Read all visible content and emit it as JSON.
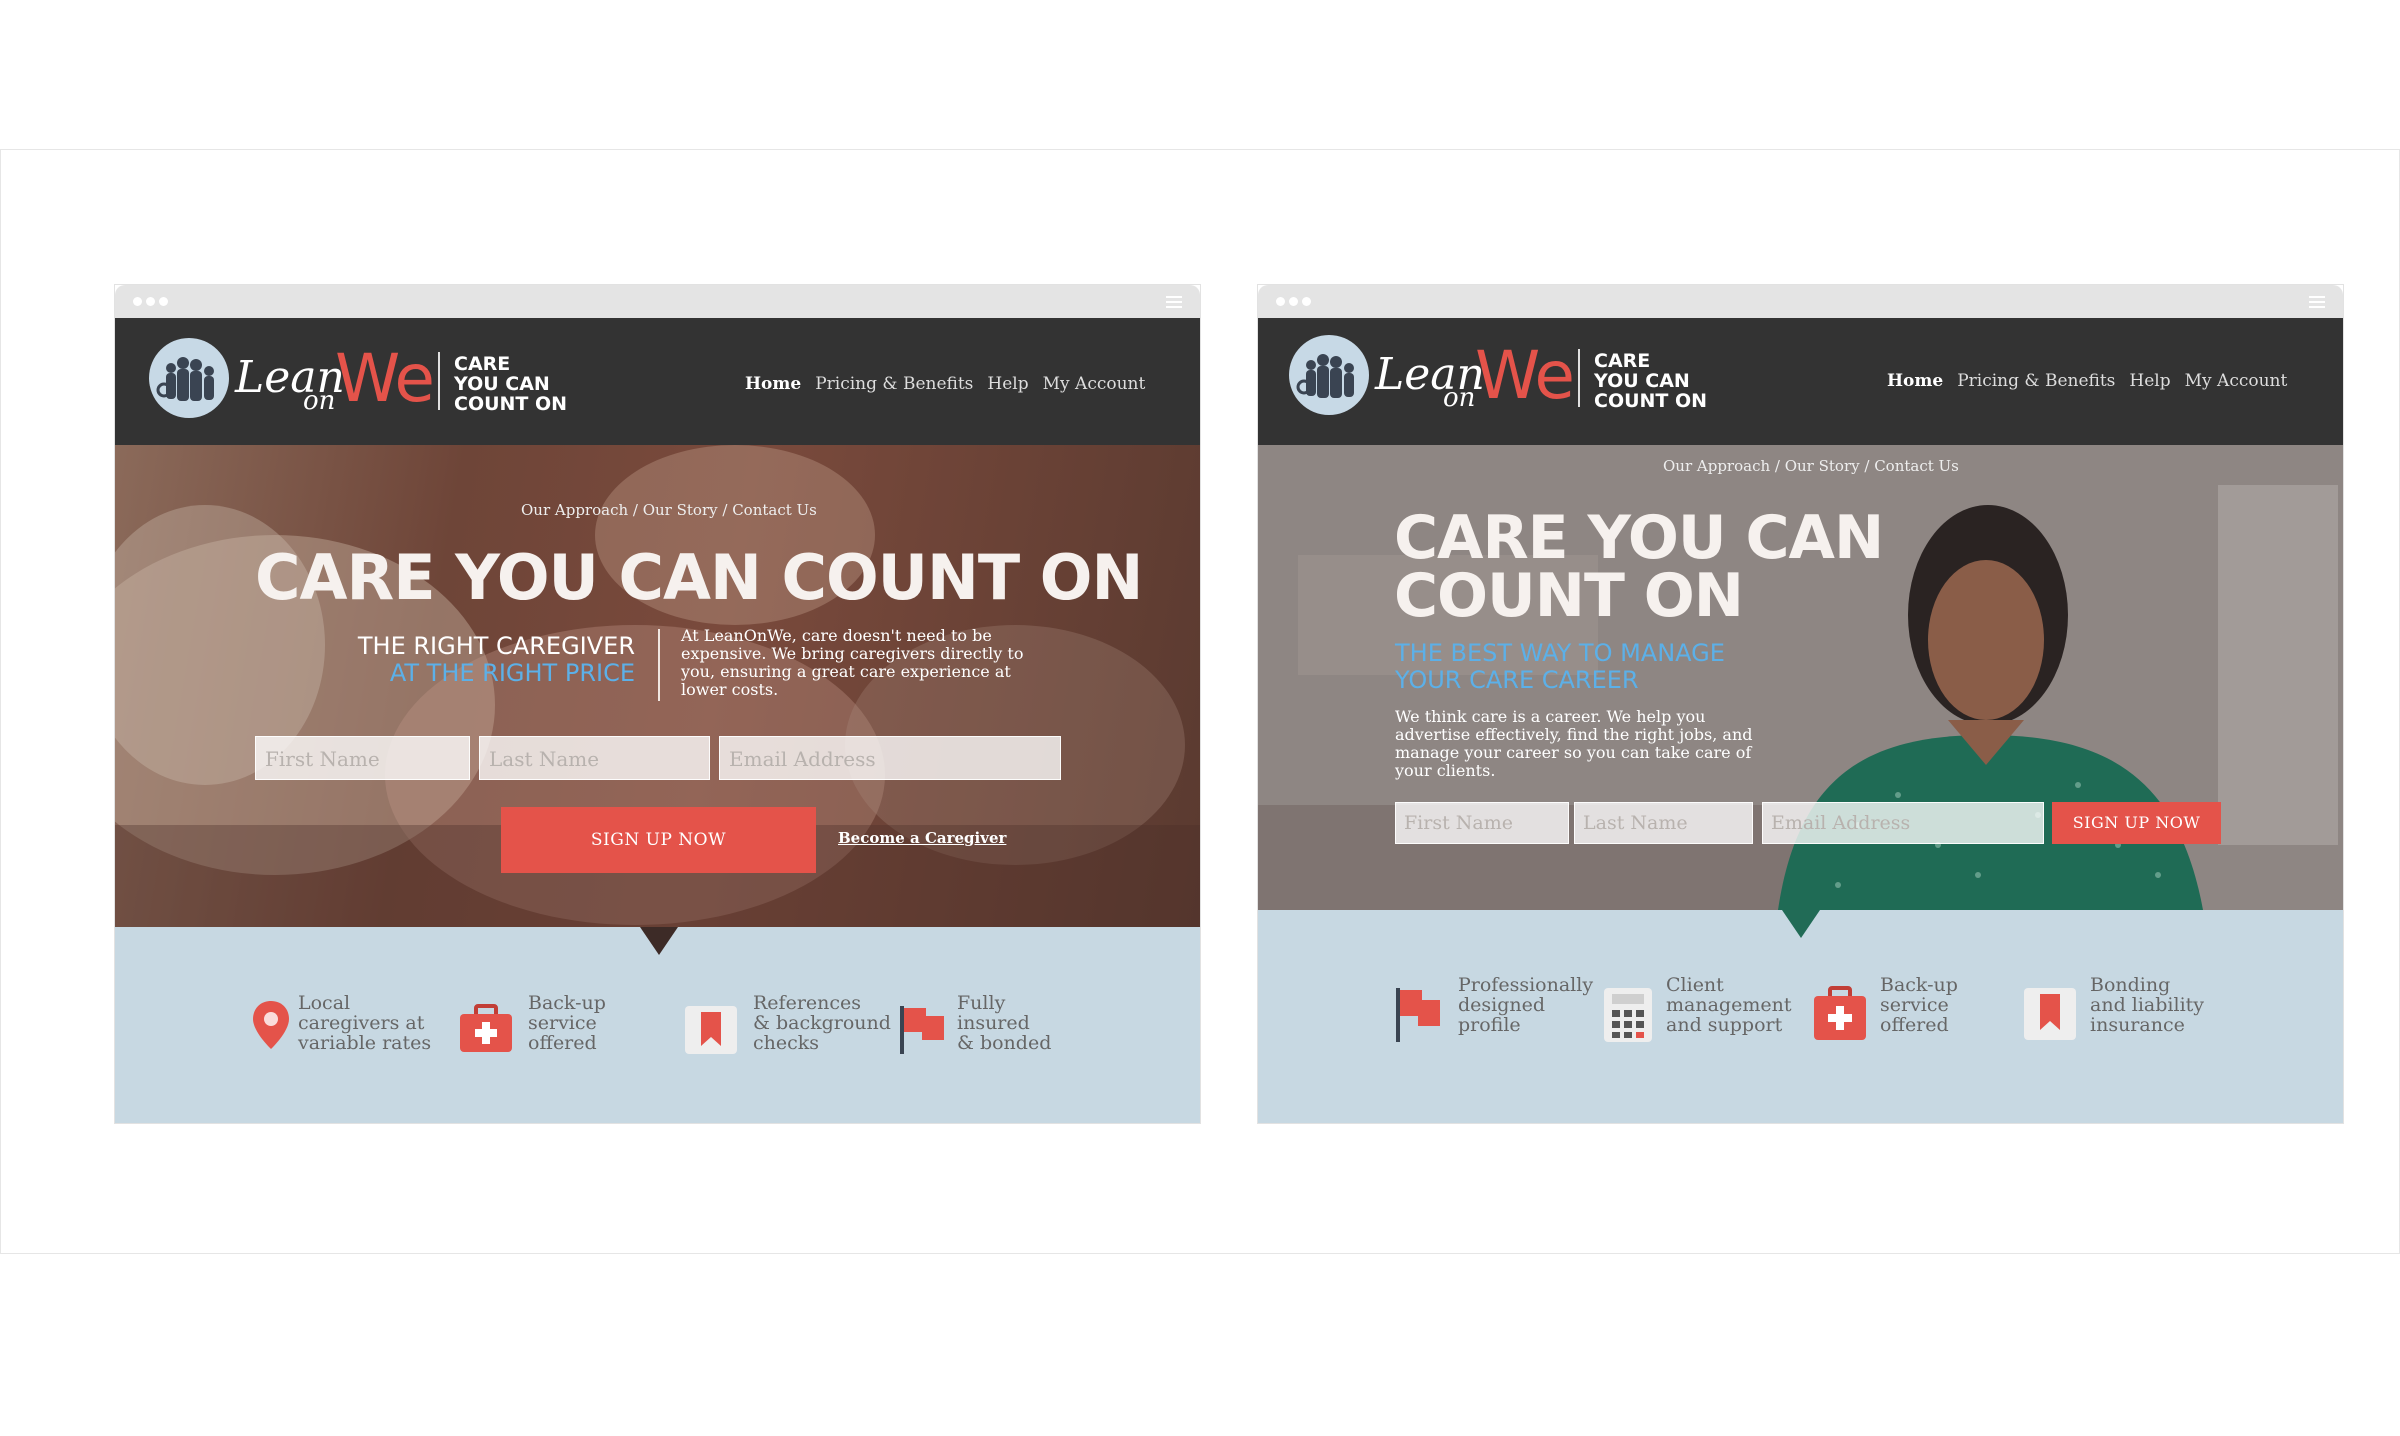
{
  "colors": {
    "accent": "#e4534a",
    "blue": "#5cb0e8",
    "nav_bg": "#333333",
    "feature_bg": "#c7d8e2"
  },
  "left": {
    "brand": {
      "lean": "Lean",
      "on": "on",
      "we": "We",
      "tagline": "CARE\nYOU CAN\nCOUNT ON"
    },
    "nav": [
      "Home",
      "Pricing & Benefits",
      "Help",
      "My Account"
    ],
    "breadcrumb": "Our Approach / Our Story /  Contact Us",
    "headline": "CARE YOU CAN COUNT ON",
    "sub1": "THE RIGHT CAREGIVER",
    "sub2": "AT THE RIGHT PRICE",
    "blurb": "At LeanOnWe, care doesn't need to be expensive. We bring caregivers directly to you, ensuring a great care experience at lower costs.",
    "form": {
      "first": "First Name",
      "last": "Last Name",
      "email": "Email Address",
      "button": "SIGN UP NOW",
      "link": "Become a Caregiver"
    },
    "features": [
      {
        "icon": "map-pin-icon",
        "text": "Local\ncaregivers at\nvariable rates"
      },
      {
        "icon": "first-aid-kit-icon",
        "text": "Back-up\nservice\noffered"
      },
      {
        "icon": "bookmark-icon",
        "text": "References\n& background\nchecks"
      },
      {
        "icon": "flag-icon",
        "text": "Fully\ninsured\n& bonded"
      }
    ]
  },
  "right": {
    "brand": {
      "lean": "Lean",
      "on": "on",
      "we": "We",
      "tagline": "CARE\nYOU CAN\nCOUNT ON"
    },
    "nav": [
      "Home",
      "Pricing & Benefits",
      "Help",
      "My Account"
    ],
    "breadcrumb": "Our Approach / Our Story /  Contact Us",
    "headline1": "CARE YOU CAN",
    "headline2": "COUNT ON",
    "sub1": "THE BEST WAY TO MANAGE",
    "sub2": "YOUR CARE CAREER",
    "blurb": "We think care is a career. We help you advertise effectively, find the right jobs, and manage your career so you can take care of your clients.",
    "form": {
      "first": "First Name",
      "last": "Last Name",
      "email": "Email Address",
      "button": "SIGN UP NOW"
    },
    "features": [
      {
        "icon": "flag-icon",
        "text": "Professionally\ndesigned\nprofile"
      },
      {
        "icon": "calculator-icon",
        "text": "Client\nmanagement\nand support"
      },
      {
        "icon": "first-aid-kit-icon",
        "text": "Back-up\nservice\noffered"
      },
      {
        "icon": "bookmark-icon",
        "text": "Bonding\nand liability\ninsurance"
      }
    ]
  }
}
